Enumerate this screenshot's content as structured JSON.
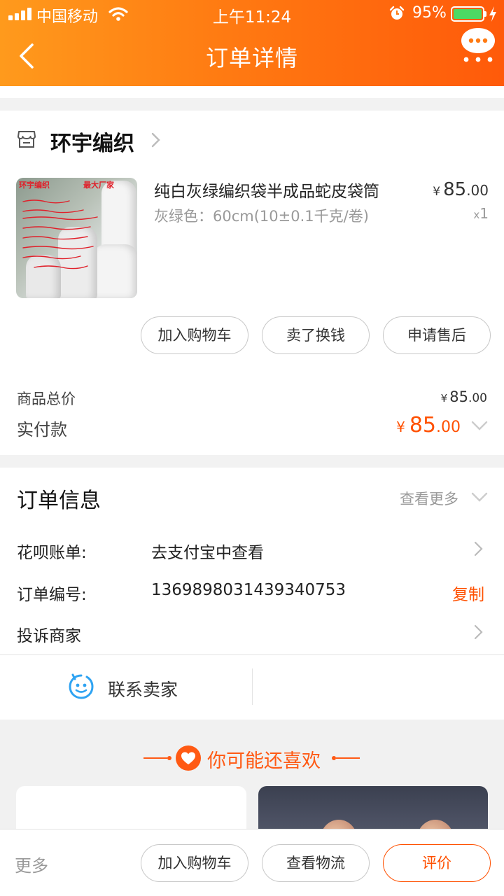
{
  "status_bar": {
    "carrier": "中国移动",
    "time": "上午11:24",
    "battery": "95%"
  },
  "nav": {
    "title": "订单详情"
  },
  "shop": {
    "name": "环宇编织",
    "product": {
      "title": "纯白灰绿编织袋半成品蛇皮袋筒",
      "sku": "灰绿色：60cm(10±0.1千克/卷)",
      "price_symbol": "¥",
      "price_int": "85",
      "price_dec": ".00",
      "qty_prefix": "x",
      "qty": "1",
      "thumb_text_1": "环宇编织",
      "thumb_text_2": "最大厂家"
    },
    "actions": [
      "加入购物车",
      "卖了换钱",
      "申请售后"
    ],
    "total_label": "商品总价",
    "total_symbol": "¥",
    "total_int": "85",
    "total_dec": ".00",
    "paid_label": "实付款",
    "paid_symbol": "¥",
    "paid_int": "85",
    "paid_dec": ".00"
  },
  "order_info": {
    "title": "订单信息",
    "more": "查看更多",
    "rows": [
      {
        "label": "花呗账单:",
        "value": "去支付宝中查看"
      },
      {
        "label": "订单编号:",
        "value": "1369898031439340753",
        "action": "复制"
      },
      {
        "label": "投诉商家"
      }
    ],
    "contact": "联系卖家"
  },
  "recommend": {
    "title": "你可能还喜欢"
  },
  "bottom_bar": {
    "more": "更多",
    "buttons": [
      "加入购物车",
      "查看物流",
      "评价"
    ]
  },
  "colors": {
    "accent": "#ff5000",
    "header_start": "#ff9a1c",
    "header_end": "#ff5a0a",
    "battery": "#4cd964"
  }
}
